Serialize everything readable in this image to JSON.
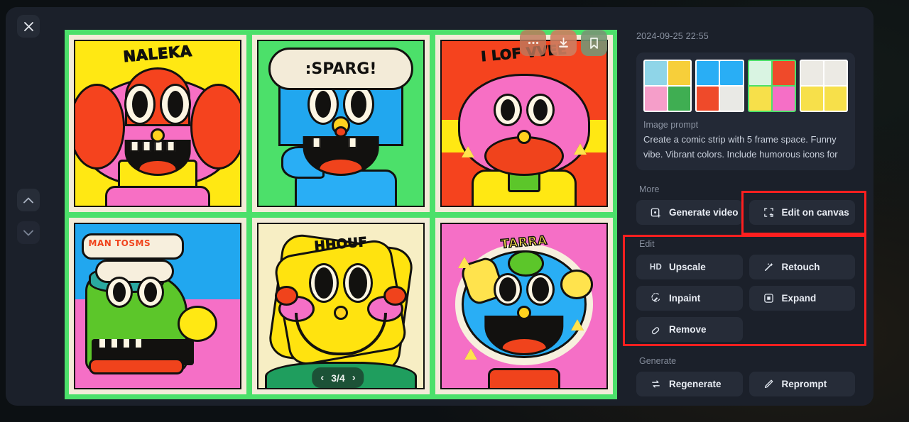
{
  "window": {
    "close_label": "✕",
    "nav_up_label": "prev",
    "nav_down_label": "next"
  },
  "viewer": {
    "pagination": {
      "current": 3,
      "total": 4,
      "label": "3/4",
      "prev": "‹",
      "next": "›"
    },
    "overlay_buttons": [
      {
        "name": "more-options",
        "icon": "ellipsis-icon",
        "label": "···"
      },
      {
        "name": "download",
        "icon": "download-icon",
        "label": "Download"
      },
      {
        "name": "bookmark",
        "icon": "bookmark-icon",
        "label": "Bookmark"
      }
    ],
    "artboard": {
      "background_color": "#4ce06a",
      "panels": [
        {
          "caption": "NALEKA",
          "bg": "#ffe813",
          "accent": "#f55ec0",
          "accent2": "#f5431e",
          "face": "#f5431e"
        },
        {
          "caption": ":SPARG!",
          "bg": "#4ce06a",
          "accent": "#21a7ef",
          "accent2": "#1789d4",
          "face": "#29aef5"
        },
        {
          "caption": "I LOF VVEE",
          "bg": "#f5431e",
          "accent": "#f76fc4",
          "accent2": "#ffe813",
          "face": "#f5431e"
        },
        {
          "caption": "MAN TOSMS",
          "bg": "#f56fc6",
          "accent": "#5cc62a",
          "accent2": "#21a7ef",
          "face": "#5cc62a"
        },
        {
          "caption": "HHOUF",
          "bg": "#f7eec4",
          "accent": "#ffd21e",
          "accent2": "#1f9e5e",
          "face": "#ffd21e"
        },
        {
          "caption": "TARRA",
          "bg": "#f56fc6",
          "accent": "#29aef5",
          "accent2": "#ffe34d",
          "face": "#29aef5"
        }
      ]
    }
  },
  "details": {
    "timestamp": "2024-09-25 22:55",
    "prompt_label": "Image prompt",
    "prompt_text": "Create a comic strip with 5 frame space. Funny vibe. Vibrant colors. Include humorous icons for decor",
    "thumbnails": [
      {
        "name": "thumbnail-1",
        "selected": false,
        "colors": [
          "#8fd5e8",
          "#f7cf3a",
          "#f59ec9",
          "#3fae52"
        ]
      },
      {
        "name": "thumbnail-2",
        "selected": false,
        "colors": [
          "#29aef5",
          "#29aef5",
          "#ef4a2a",
          "#f0f0ee"
        ]
      },
      {
        "name": "thumbnail-3",
        "selected": true,
        "colors": [
          "#4ce06a",
          "#ef4a2a",
          "#f7e04a",
          "#f56fc6"
        ]
      },
      {
        "name": "thumbnail-4",
        "selected": false,
        "colors": [
          "#f2f2f0",
          "#f2f2f0",
          "#f7e04a",
          "#f7e04a"
        ]
      }
    ]
  },
  "sections": {
    "more": {
      "title": "More",
      "buttons": [
        {
          "name": "generate-video-button",
          "label": "Generate video",
          "icon": "video-frame-icon"
        },
        {
          "name": "edit-on-canvas-button",
          "label": "Edit on canvas",
          "icon": "canvas-crop-icon",
          "highlighted": true
        }
      ]
    },
    "edit": {
      "title": "Edit",
      "highlighted": true,
      "buttons": [
        {
          "name": "upscale-button",
          "label": "Upscale",
          "icon": "hd-icon"
        },
        {
          "name": "retouch-button",
          "label": "Retouch",
          "icon": "magic-wand-icon"
        },
        {
          "name": "inpaint-button",
          "label": "Inpaint",
          "icon": "inpaint-brush-icon"
        },
        {
          "name": "expand-button",
          "label": "Expand",
          "icon": "expand-frame-icon"
        },
        {
          "name": "remove-button",
          "label": "Remove",
          "icon": "eraser-icon"
        }
      ]
    },
    "generate": {
      "title": "Generate",
      "buttons": [
        {
          "name": "regenerate-button",
          "label": "Regenerate",
          "icon": "refresh-icon"
        },
        {
          "name": "reprompt-button",
          "label": "Reprompt",
          "icon": "pencil-icon"
        }
      ]
    }
  },
  "annotations": {
    "highlight_color": "#ff1f1f",
    "boxes": [
      {
        "name": "highlight-edit-on-canvas",
        "target": "Edit on canvas"
      },
      {
        "name": "highlight-edit-section",
        "target": "Edit"
      }
    ]
  }
}
